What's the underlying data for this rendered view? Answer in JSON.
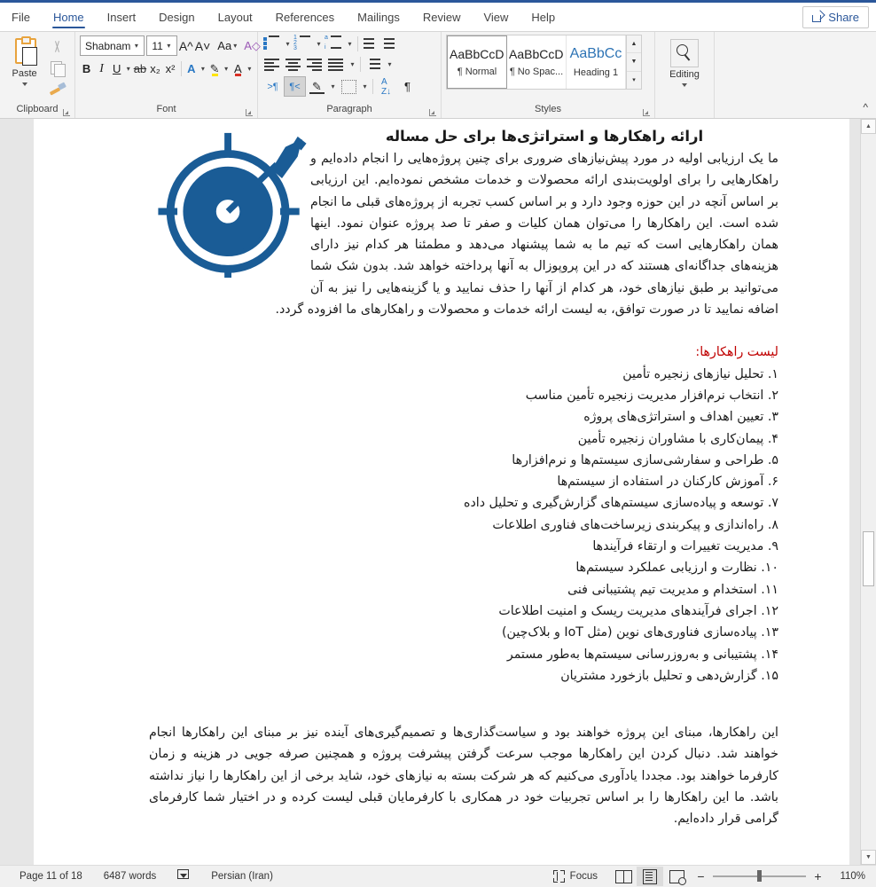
{
  "app": {
    "share_label": "Share"
  },
  "tabs": [
    {
      "label": "File",
      "active": false
    },
    {
      "label": "Home",
      "active": true
    },
    {
      "label": "Insert",
      "active": false
    },
    {
      "label": "Design",
      "active": false
    },
    {
      "label": "Layout",
      "active": false
    },
    {
      "label": "References",
      "active": false
    },
    {
      "label": "Mailings",
      "active": false
    },
    {
      "label": "Review",
      "active": false
    },
    {
      "label": "View",
      "active": false
    },
    {
      "label": "Help",
      "active": false
    }
  ],
  "ribbon": {
    "clipboard": {
      "group_label": "Clipboard",
      "paste_label": "Paste"
    },
    "font": {
      "group_label": "Font",
      "font_name": "Shabnam",
      "font_size": "11"
    },
    "paragraph": {
      "group_label": "Paragraph"
    },
    "styles": {
      "group_label": "Styles",
      "items": [
        {
          "preview": "AaBbCcDc",
          "name": "¶ Normal",
          "selected": true
        },
        {
          "preview": "AaBbCcDc",
          "name": "¶ No Spac...",
          "selected": false
        },
        {
          "preview": "AaBbCc",
          "name": "Heading 1",
          "selected": false
        }
      ]
    },
    "editing": {
      "group_label": "",
      "button_label": "Editing"
    }
  },
  "document": {
    "title": "ارائه راهکارها و استراتژی‌ها برای حل مساله",
    "paragraph1": "ما یک ارزیابی اولیه در مورد پیش‌نیازهای ضروری برای چنین پروژه‌هایی را انجام داده‌ایم و راهکارهایی را برای اولویت‌بندی ارائه محصولات و خدمات مشخص نموده‌ایم. این ارزیابی بر اساس آنچه در این حوزه وجود دارد و بر اساس کسب تجربه از پروژه‌های قبلی ما انجام شده است. این راهکارها را می‌توان همان کلیات و صفر تا صد پروژه عنوان نمود. اینها همان راهکارهایی است که تیم ما به شما پیشنهاد می‌دهد و مطمئنا هر کدام نیز دارای هزینه‌های جداگانه‌ای هستند که در این پروپوزال به آنها پرداخته خواهد شد. بدون شک شما می‌توانید بر طبق نیازهای خود، هر کدام از آنها را حذف نمایید و یا گزینه‌هایی را نیز به آن اضافه نمایید تا در صورت توافق، به لیست ارائه خدمات و محصولات و راهکارهای ما افزوده گردد.",
    "list_heading": "لیست راهکارها:",
    "list_items": [
      "۱. تحلیل نیازهای زنجیره تأمین",
      "۲. انتخاب نرم‌افزار مدیریت زنجیره تأمین مناسب",
      "۳. تعیین اهداف و استراتژی‌های پروژه",
      "۴. پیمان‌کاری با مشاوران زنجیره تأمین",
      "۵. طراحی و سفارشی‌سازی سیستم‌ها و نرم‌افزارها",
      "۶. آموزش کارکنان در استفاده از سیستم‌ها",
      "۷. توسعه و پیاده‌سازی سیستم‌های گزارش‌گیری و تحلیل داده",
      "۸. راه‌اندازی و پیکربندی زیرساخت‌های فناوری اطلاعات",
      "۹. مدیریت تغییرات و ارتقاء فرآیندها",
      "۱۰. نظارت و ارزیابی عملکرد سیستم‌ها",
      "۱۱. استخدام و مدیریت تیم پشتیبانی فنی",
      "۱۲. اجرای فرآیندهای مدیریت ریسک و امنیت اطلاعات",
      "۱۳. پیاده‌سازی فناوری‌های نوین (مثل IoT و بلاک‌چین)",
      "۱۴. پشتیبانی و به‌روزرسانی سیستم‌ها به‌طور مستمر",
      "۱۵. گزارش‌دهی و تحلیل بازخورد مشتریان"
    ],
    "paragraph2": "این راهکارها، مبنای این پروژه خواهند بود و سیاست‌گذاری‌ها و تصمیم‌گیری‌های آینده نیز بر مبنای این راهکارها انجام خواهند شد. دنبال کردن این راهکارها موجب سرعت گرفتن پیشرفت پروژه و همچنین صرفه جویی در هزینه و زمان کارفرما خواهند بود. مجددا یادآوری می‌کنیم که هر شرکت بسته به نیازهای خود، شاید برخی از این راهکارها را نیاز نداشته باشد. ما این راهکارها را بر اساس تجربیات خود در همکاری با کارفرمایان قبلی لیست کرده و در اختیار شما کارفرمای گرامی قرار داده‌ایم.",
    "image_alt": "target-dartboard-with-arrow",
    "image_color": "#1a5c96"
  },
  "status": {
    "page": "Page 11 of 18",
    "words": "6487 words",
    "language": "Persian (Iran)",
    "focus_label": "Focus",
    "zoom": "110%"
  },
  "colors": {
    "accent": "#2b579a",
    "heading_red": "#c00000",
    "image_blue": "#1a5c96"
  }
}
